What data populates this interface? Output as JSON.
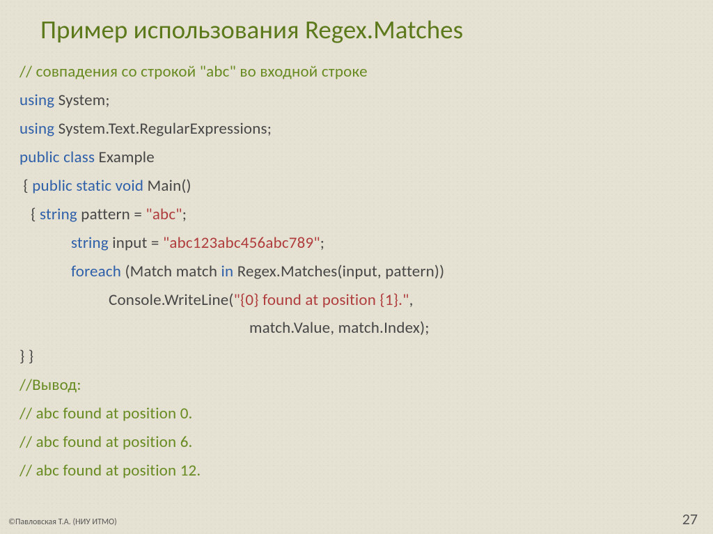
{
  "title": "Пример использования Regex.Matches",
  "footer": "©Павловская Т.А. (НИУ ИТМО)",
  "pagenum": "27",
  "c": {
    "l01_com": "// совпадения со строкой \"abc\" во входной строке",
    "l02_kw": "using",
    "l02_txt": " System;",
    "l03_kw": "using",
    "l03_txt": " System.Text.RegularExpressions;",
    "l04_kw": "public class",
    "l04_txt": " Example",
    "l05a": " { ",
    "l05_kw": "public static void",
    "l05_txt": " Main()",
    "l06a": "   { ",
    "l06_kw": "string",
    "l06_txt1": " pattern = ",
    "l06_str": "\"abc\"",
    "l06_txt2": ";",
    "l07_kw": "string",
    "l07_txt1": " input = ",
    "l07_str": "\"abc123abc456abc789\"",
    "l07_txt2": ";",
    "l08_kw1": "foreach",
    "l08_txt1": " (Match match ",
    "l08_kw2": "in",
    "l08_txt2": " Regex.Matches(input, pattern))",
    "l09_txt1": "Console.WriteLine(",
    "l09_str": "\"{0} found at position {1}.\"",
    "l09_txt2": ",",
    "l10_txt": "match.Value, match.Index);",
    "l11": "} }",
    "l12_com": "//Вывод:",
    "l13_com": "// abc found at position 0.",
    "l14_com": "// abc found at position 6.",
    "l15_com": "// abc found at position 12."
  }
}
